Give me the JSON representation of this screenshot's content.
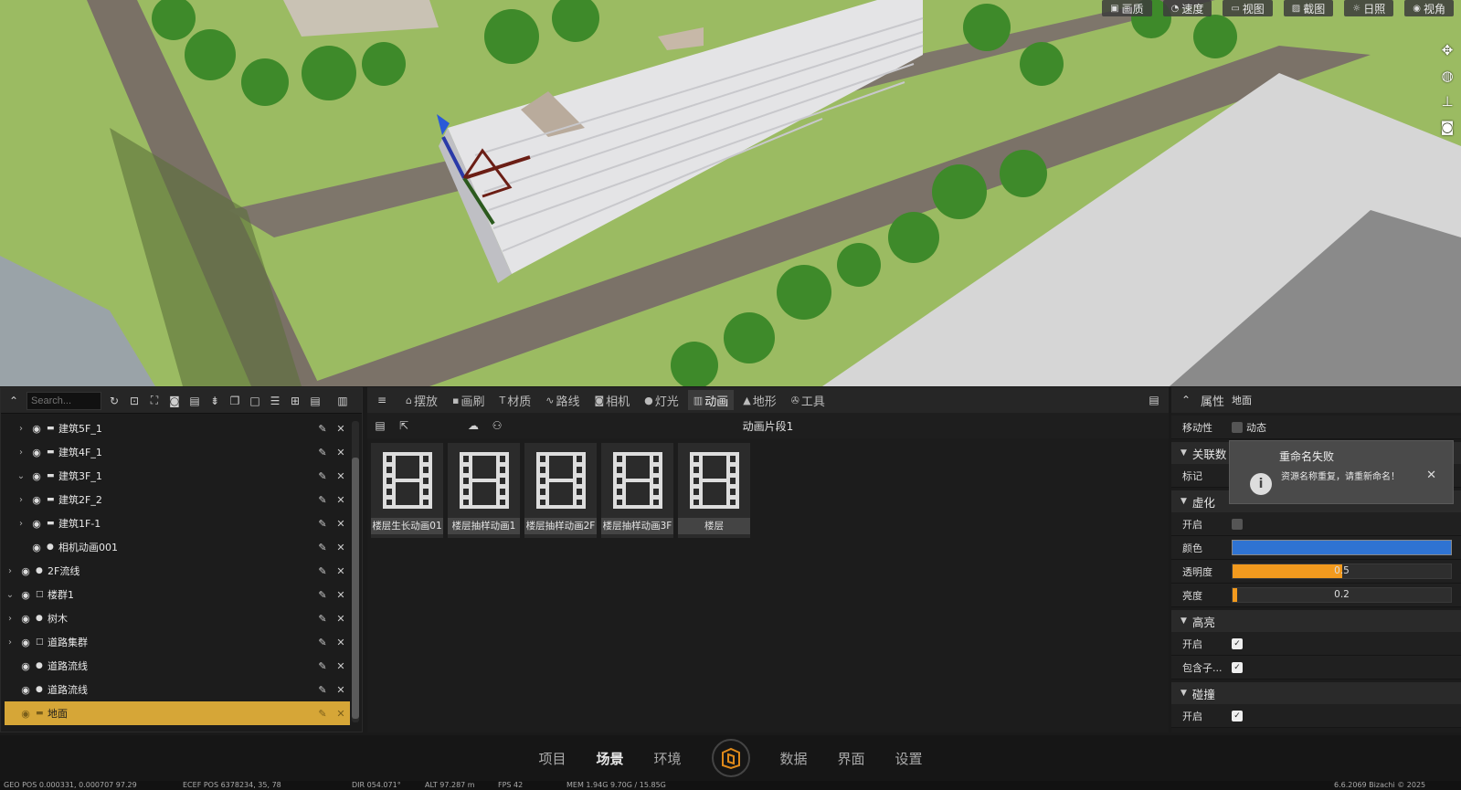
{
  "viewport": {
    "toolbar": [
      {
        "icon": "image-icon",
        "label": "画质"
      },
      {
        "icon": "speed-icon",
        "label": "速度"
      },
      {
        "icon": "view-icon",
        "label": "视图"
      },
      {
        "icon": "screenshot-icon",
        "label": "截图"
      },
      {
        "icon": "sun-icon",
        "label": "日照"
      },
      {
        "icon": "eye-icon",
        "label": "视角"
      }
    ]
  },
  "outliner": {
    "search_placeholder": "Search...",
    "items": [
      {
        "label": "建筑5F_1",
        "expand": "›",
        "type": "mesh"
      },
      {
        "label": "建筑4F_1",
        "expand": "›",
        "type": "mesh"
      },
      {
        "label": "建筑3F_1",
        "expand": "⌄",
        "type": "mesh"
      },
      {
        "label": "建筑2F_2",
        "expand": "›",
        "type": "mesh"
      },
      {
        "label": "建筑1F-1",
        "expand": "›",
        "type": "mesh"
      },
      {
        "label": "相机动画001",
        "expand": "",
        "type": "pin"
      },
      {
        "label": "2F流线",
        "expand": "›",
        "type": "pin"
      },
      {
        "label": "楼群1",
        "expand": "⌄",
        "type": "group"
      },
      {
        "label": "树木",
        "expand": "›",
        "type": "pin"
      },
      {
        "label": "道路集群",
        "expand": "›",
        "type": "group"
      },
      {
        "label": "道路流线",
        "expand": "",
        "type": "pin"
      },
      {
        "label": "道路流线",
        "expand": "",
        "type": "pin"
      },
      {
        "label": "地面",
        "expand": "",
        "type": "mesh",
        "selected": true
      }
    ]
  },
  "content_browser": {
    "tabs": [
      {
        "icon": "place-icon",
        "label": "摆放"
      },
      {
        "icon": "brush-icon",
        "label": "画刷"
      },
      {
        "icon": "material-icon",
        "label": "材质"
      },
      {
        "icon": "route-icon",
        "label": "路线"
      },
      {
        "icon": "camera-icon",
        "label": "相机"
      },
      {
        "icon": "light-icon",
        "label": "灯光"
      },
      {
        "icon": "animation-icon",
        "label": "动画",
        "active": true
      },
      {
        "icon": "terrain-icon",
        "label": "地形"
      },
      {
        "icon": "wrench-icon",
        "label": "工具"
      }
    ],
    "title": "动画片段1",
    "assets": [
      {
        "name": "楼层生长动画01"
      },
      {
        "name": "楼层抽样动画1"
      },
      {
        "name": "楼层抽样动画2F"
      },
      {
        "name": "楼层抽样动画3F"
      },
      {
        "name": "楼层"
      }
    ]
  },
  "details": {
    "title": "属性",
    "subtitle": "地面",
    "mobility_label": "移动性",
    "mobility_value": "动态",
    "sections": {
      "link": "关联数",
      "tag_label": "标记",
      "virtualize": "虚化",
      "enable": "开启",
      "color": "颜色",
      "opacity": "透明度",
      "opacity_value": "0.5",
      "brightness": "亮度",
      "brightness_value": "0.2",
      "highlight": "高亮",
      "include_children": "包含子...",
      "collision": "碰撞"
    },
    "colors": {
      "accent": "#f29a1e",
      "virtual_color": "#2f73d2"
    },
    "opacity_level": 0.5,
    "brightness_level": 0.02
  },
  "toast": {
    "title": "重命名失败",
    "message": "资源名称重复，请重新命名！"
  },
  "nav": {
    "items": [
      "项目",
      "场景",
      "环境",
      "数据",
      "界面",
      "设置"
    ],
    "active": "场景"
  },
  "status": {
    "geo": "GEO POS 0.000331, 0.000707 97.29",
    "ecef": "ECEF POS 6378234, 35, 78",
    "dir": "DIR 054.071°",
    "alt": "ALT 97.287 m",
    "fps": "FPS 42",
    "mem": "MEM 1.94G 9.70G / 15.85G",
    "version": "6.6.2069 Bizachi © 2025"
  }
}
